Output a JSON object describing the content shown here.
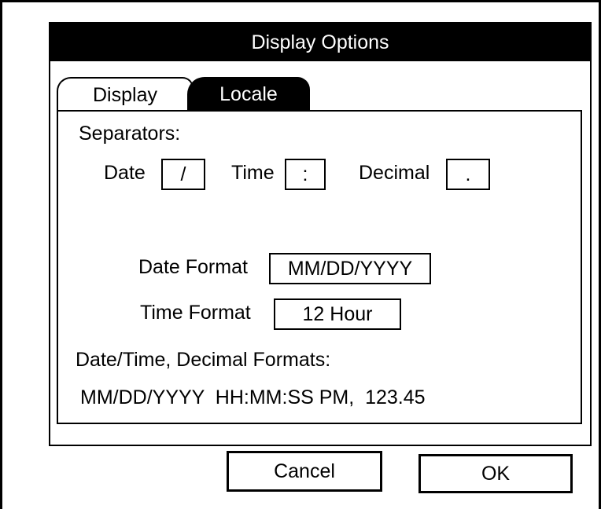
{
  "dialog": {
    "title": "Display Options",
    "tabs": [
      {
        "label": "Display",
        "active": false
      },
      {
        "label": "Locale",
        "active": true
      }
    ]
  },
  "separators": {
    "heading": "Separators:",
    "date_label": "Date",
    "date_value": "/",
    "time_label": "Time",
    "time_value": ":",
    "decimal_label": "Decimal",
    "decimal_value": "."
  },
  "formats": {
    "date_format_label": "Date Format",
    "date_format_value": "MM/DD/YYYY",
    "time_format_label": "Time Format",
    "time_format_value": "12 Hour"
  },
  "preview": {
    "label": "Date/Time, Decimal Formats:",
    "value": "MM/DD/YYYY  HH:MM:SS PM,  123.45"
  },
  "buttons": {
    "cancel": "Cancel",
    "ok": "OK"
  },
  "colors": {
    "foreground": "#000000",
    "background": "#ffffff"
  }
}
